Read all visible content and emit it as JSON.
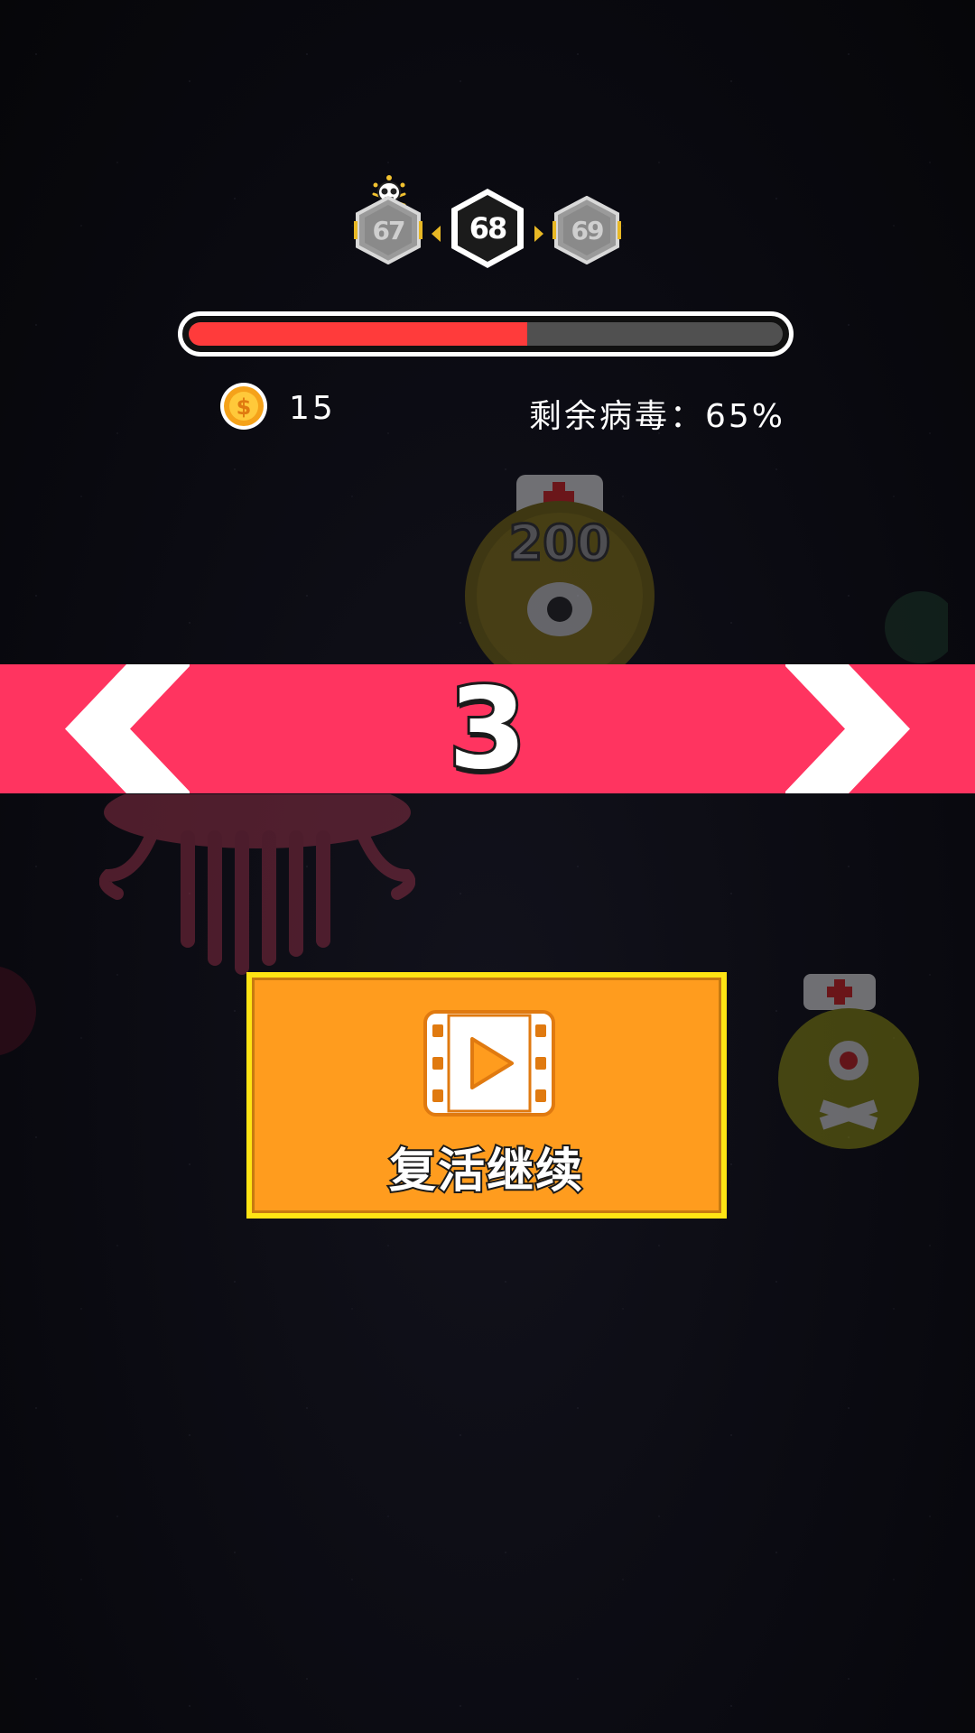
{
  "level_selector": {
    "prev_level": "67",
    "current_level": "68",
    "next_level": "69"
  },
  "progress": {
    "fraction": 0.57,
    "fill_color": "#ff3b3b",
    "track_color": "#505050"
  },
  "stats": {
    "coin_count": "15",
    "remaining_virus_text": "剩余病毒：65%"
  },
  "background_monsters": {
    "boss_hp": "200"
  },
  "countdown": {
    "value": "3",
    "banner_color": "#ff3460"
  },
  "revive_button": {
    "label": "复活继续",
    "icon": "video-play-icon",
    "color": "#ff9c1e",
    "border_color": "#ffe414"
  }
}
